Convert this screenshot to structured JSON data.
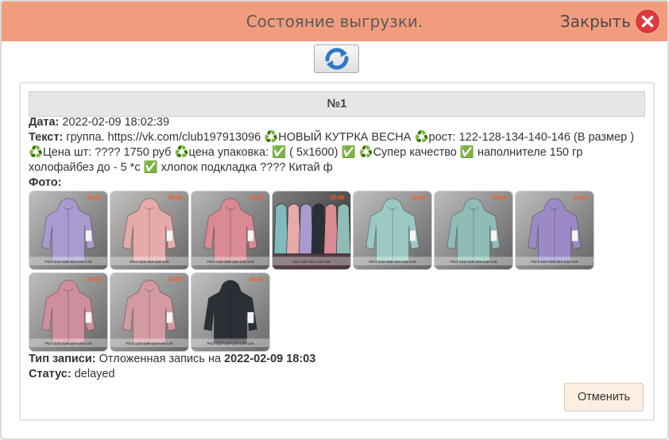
{
  "modal": {
    "title": "Состояние выгрузки.",
    "close_label": "Закрыть"
  },
  "record": {
    "number": "№1",
    "date_label": "Дата:",
    "date_value": "2022-02-09 18:02:39",
    "text_label": "Текст:",
    "text_value": "группа. https://vk.com/club197913096 ♻️НОВЫЙ КУТРКА ВЕСНА ♻️рост: 122-128-134-140-146 (В размер ) ♻️Цена шт: ???? 1750 руб ♻️цена упаковка: ✅ ( 5х1600) ✅ ♻️Супер качество ✅ наполнителе 150 гр холофайбез до - 5 *с ✅ хлопок подкладка ???? Китай ф",
    "photo_label": "Фото:",
    "photos": [
      {
        "alt": "lilac jacket photo",
        "coat": "#a99ad0",
        "bg": "#9b9b9b",
        "caption": "Рост:122-128-134-140-146",
        "badge": "25-08"
      },
      {
        "alt": "pink jacket photo",
        "coat": "#e6aaa9",
        "bg": "#a39f9c",
        "caption": "Рост:122-134-140-146",
        "badge": "25-08"
      },
      {
        "alt": "pink jacket open photo",
        "coat": "#d98a93",
        "bg": "#8f8f8f",
        "caption": "Рост:122-128-134-140-146",
        "badge": "25-08"
      },
      {
        "alt": "jackets on rack photo",
        "coat": "#7fbcbb",
        "bg": "#3a3a3a",
        "caption": "122-128-134-140-146",
        "badge": "25-08"
      },
      {
        "alt": "mint jacket photo",
        "coat": "#9cc9c3",
        "bg": "#9c9c9c",
        "caption": "Рост:122-128-134-140-146",
        "badge": "25-08"
      },
      {
        "alt": "mint jacket flat photo",
        "coat": "#8fbcb6",
        "bg": "#979797",
        "caption": "Рост:122-128-134-140-146",
        "badge": "25-08"
      },
      {
        "alt": "purple jacket photo",
        "coat": "#9c8ac8",
        "bg": "#9b9b9b",
        "caption": "Рост:122-128-134-140-146",
        "badge": "25-08"
      },
      {
        "alt": "rose jacket photo",
        "coat": "#cf8e9c",
        "bg": "#9a9a9a",
        "caption": "Рост:122-128-134-140-146",
        "badge": "25-08"
      },
      {
        "alt": "rose jacket open photo",
        "coat": "#d39aa1",
        "bg": "#9e9e9e",
        "caption": "Рост:122-128-134-140-146",
        "badge": "25-08"
      },
      {
        "alt": "black jacket photo",
        "coat": "#2b2f36",
        "bg": "#a1a1a1",
        "caption": "Рост:122-128-134-140-146",
        "badge": "25-08"
      }
    ],
    "type_label": "Тип записи:",
    "type_value": "Отложенная запись на",
    "type_datetime": "2022-02-09 18:03",
    "status_label": "Статус:",
    "status_value": "delayed",
    "cancel_label": "Отменить"
  },
  "colors": {
    "header_bg": "#f29c7e",
    "close_icon": "#e0393f",
    "refresh_icon": "#2e78c9"
  },
  "icons": {
    "close": "close-icon",
    "refresh": "refresh-icon"
  }
}
